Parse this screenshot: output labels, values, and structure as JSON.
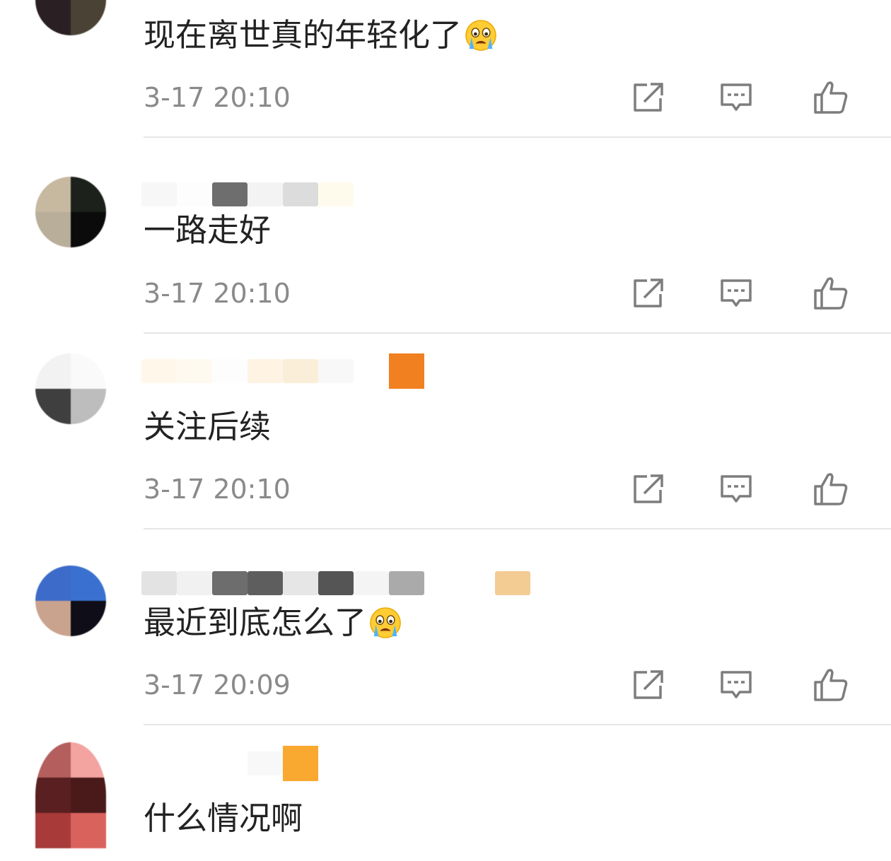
{
  "colors": {
    "text": "#222222",
    "time": "#8a8a8a",
    "icon": "#7d7d7d",
    "divider": "#e6e6e6",
    "badge_orange": "#f08020",
    "badge_yellow": "#f9a830"
  },
  "actions": {
    "share_icon": "share-icon",
    "comment_icon": "comment-icon",
    "like_icon": "like-icon"
  },
  "comments": [
    {
      "text": "现在离世真的年轻化了",
      "emoji": "crying-face-emoji",
      "time": "3-17 20:10"
    },
    {
      "text": "一路走好",
      "emoji": null,
      "time": "3-17 20:10"
    },
    {
      "text": "关注后续",
      "emoji": null,
      "time": "3-17 20:10"
    },
    {
      "text": "最近到底怎么了",
      "emoji": "crying-face-emoji",
      "time": "3-17 20:09"
    },
    {
      "text": "什么情况啊",
      "emoji": null,
      "time": ""
    }
  ]
}
